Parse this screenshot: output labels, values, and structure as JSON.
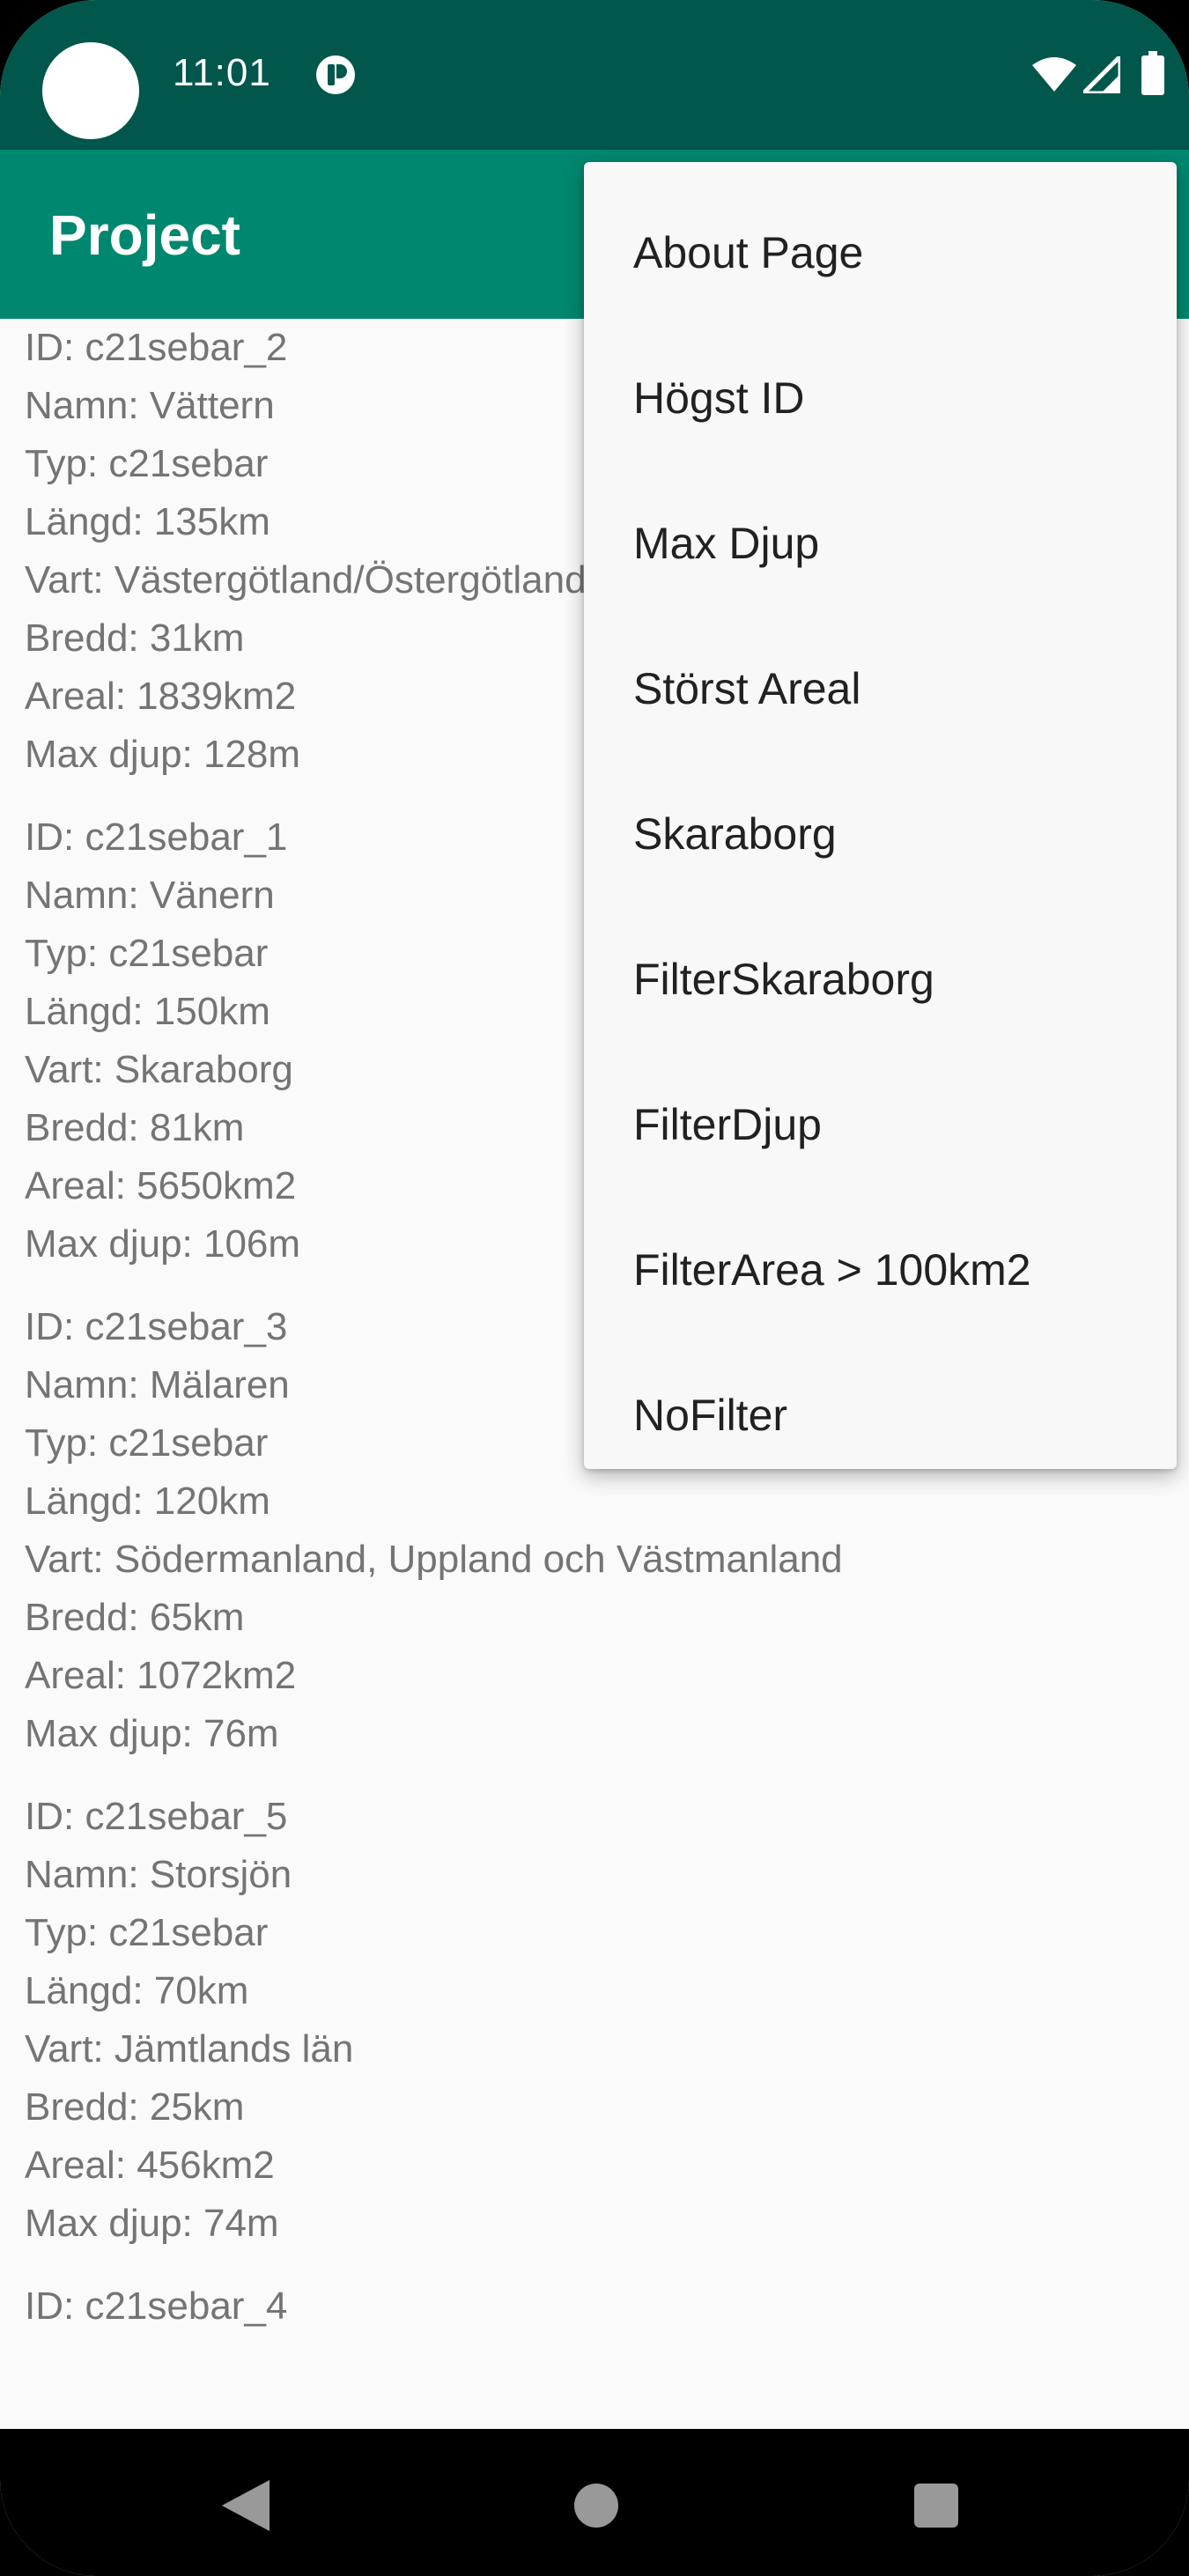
{
  "status_bar": {
    "time": "11:01"
  },
  "app_bar": {
    "title": "Project"
  },
  "records": [
    {
      "lines": [
        "ID: c21sebar_2",
        "Namn: Vättern",
        "Typ: c21sebar",
        "Längd: 135km",
        "Vart: Västergötland/Östergötland",
        "Bredd: 31km",
        "Areal: 1839km2",
        "Max djup: 128m"
      ]
    },
    {
      "lines": [
        "ID: c21sebar_1",
        "Namn: Vänern",
        "Typ: c21sebar",
        "Längd: 150km",
        "Vart: Skaraborg",
        "Bredd: 81km",
        "Areal: 5650km2",
        "Max djup: 106m"
      ]
    },
    {
      "lines": [
        "ID: c21sebar_3",
        "Namn: Mälaren",
        "Typ: c21sebar",
        "Längd: 120km",
        "Vart: Södermanland, Uppland och Västmanland",
        "Bredd: 65km",
        "Areal: 1072km2",
        "Max djup: 76m"
      ]
    },
    {
      "lines": [
        "ID: c21sebar_5",
        "Namn: Storsjön",
        "Typ: c21sebar",
        "Längd: 70km",
        "Vart: Jämtlands län",
        "Bredd: 25km",
        "Areal: 456km2",
        "Max djup: 74m"
      ]
    },
    {
      "lines": [
        "ID: c21sebar_4"
      ]
    }
  ],
  "menu": {
    "items": [
      "About Page",
      "Högst ID",
      "Max Djup",
      "Störst Areal",
      "Skaraborg",
      "FilterSkaraborg",
      "FilterDjup",
      "FilterArea > 100km2",
      "NoFilter"
    ]
  },
  "colors": {
    "status_bar": "#01574b",
    "app_bar": "#00876f",
    "background": "#fafafa",
    "text_secondary": "#747474",
    "menu_background": "#f8f8f8"
  },
  "icons": {
    "status": [
      "notification-icon",
      "wifi-icon",
      "signal-icon",
      "battery-icon"
    ],
    "navigation": [
      "back-icon",
      "home-icon",
      "recents-icon"
    ]
  }
}
